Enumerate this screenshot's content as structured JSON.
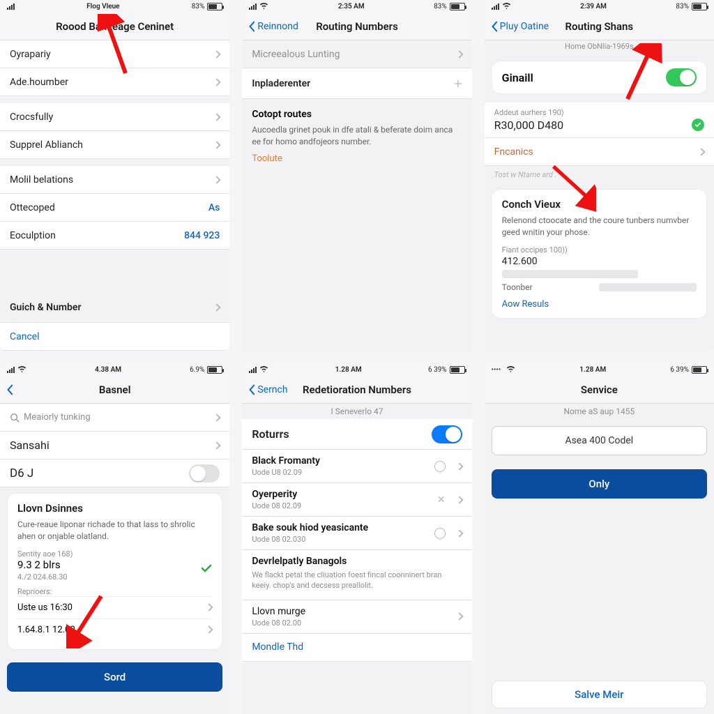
{
  "s1": {
    "statusCenter": "Flog Vleue",
    "statusRight": "83%",
    "title": "Roood Bankeage Ceninet",
    "rows": [
      {
        "label": "Oyrapariy"
      },
      {
        "label": "Ade.houmber"
      },
      {
        "label": "Crocsfully"
      },
      {
        "label": "Supprel Ablianch"
      },
      {
        "label": "Molil belations"
      },
      {
        "label": "Ottecoped",
        "value": "As"
      },
      {
        "label": "Eoculption",
        "value": "844 923"
      }
    ],
    "bottomRow": "Guich & Number",
    "cancel": "Cancel"
  },
  "s2": {
    "statusCenter": "2:35 AM",
    "statusRight": "83%",
    "back": "Reinnond",
    "title": "Routing Numbers",
    "row1": "Micreealous Lunting",
    "row2": "Inpladerenter",
    "heading": "Cotopt routes",
    "body": "Aucoedla grinet pouk in dfe atali & beferate doim anca ee for homo andfojeors number.",
    "link": "Toolute"
  },
  "s3": {
    "statusCenter": "2:39 AM",
    "statusRight": "83%",
    "back": "Pluy Oatine",
    "title": "Routing Shans",
    "breadcrumb": "Home ObNlia-1969s",
    "toggleLabel": "Ginaill",
    "addLabel": "Addeut aurhers 190)",
    "addValue": "R30,000 D480",
    "financeRow": "Fncanics",
    "hint": "Tost w Ntame ard .",
    "cardTitle": "Conch Vieux",
    "cardBody": "Relenond ctoocate and the coure tunbers numvber geed wnitin your phose.",
    "fiant": "Fiant occipes 100))",
    "fiantVal": "412.600",
    "fiantRow": "Toonber",
    "resultLink": "Aow Resuls"
  },
  "s4": {
    "statusCenter": "4.38 AM",
    "statusRight": "6.9%",
    "title": "Basnel",
    "searchPlaceholder": "Meaiorly tunking",
    "rowA": "Sansahi",
    "rowB": "D6 J",
    "cardTitle": "Llovn Dsinnes",
    "cardBody": "Cure-reaue liponar richade to that lass to shrolic ahen or onjable olatland.",
    "sentity": "Sentity aoe 168)",
    "sentityVal": "9.3 2 blrs",
    "sentitySub": "4./2 024.68.30",
    "repLabel": "Reprioers:",
    "rep1": "Uste us 16:30",
    "rep2": "1.64.8.1 12.00",
    "button": "Sord"
  },
  "s5": {
    "statusCenter": "1.28 AM",
    "statusRight": "6 39%",
    "back": "Sernch",
    "title": "Redetioration Numbers",
    "subtitle": "I Seneverlo 47",
    "toggleLabel": "Roturrs",
    "items": [
      {
        "main": "Black Fromanty",
        "sub": "Uode U8 02.09",
        "icon": "circle"
      },
      {
        "main": "Oyerperity",
        "sub": "Uode 08 02.09",
        "icon": "x"
      },
      {
        "main": "Bake souk hiod yeasicante",
        "sub": "Uode 08 02.030",
        "icon": "circle"
      }
    ],
    "dev": "Devrlelpatly Banagols",
    "devBody": "We flackt petal the cliuation foest fincal coonninert bran keeiy. chop's and decsess preallolit.",
    "last": {
      "main": "Llovn murge",
      "sub": "Uode 08 02.00"
    },
    "link": "Mondle Thd"
  },
  "s6": {
    "statusCenter": "1.28 AM",
    "statusRight": "6 39%",
    "title": "Senvice",
    "subtitle": "Nome aS aup 1455",
    "input": "Asea 400 Codel",
    "button": "Only",
    "bottom": "Salve Meir"
  }
}
